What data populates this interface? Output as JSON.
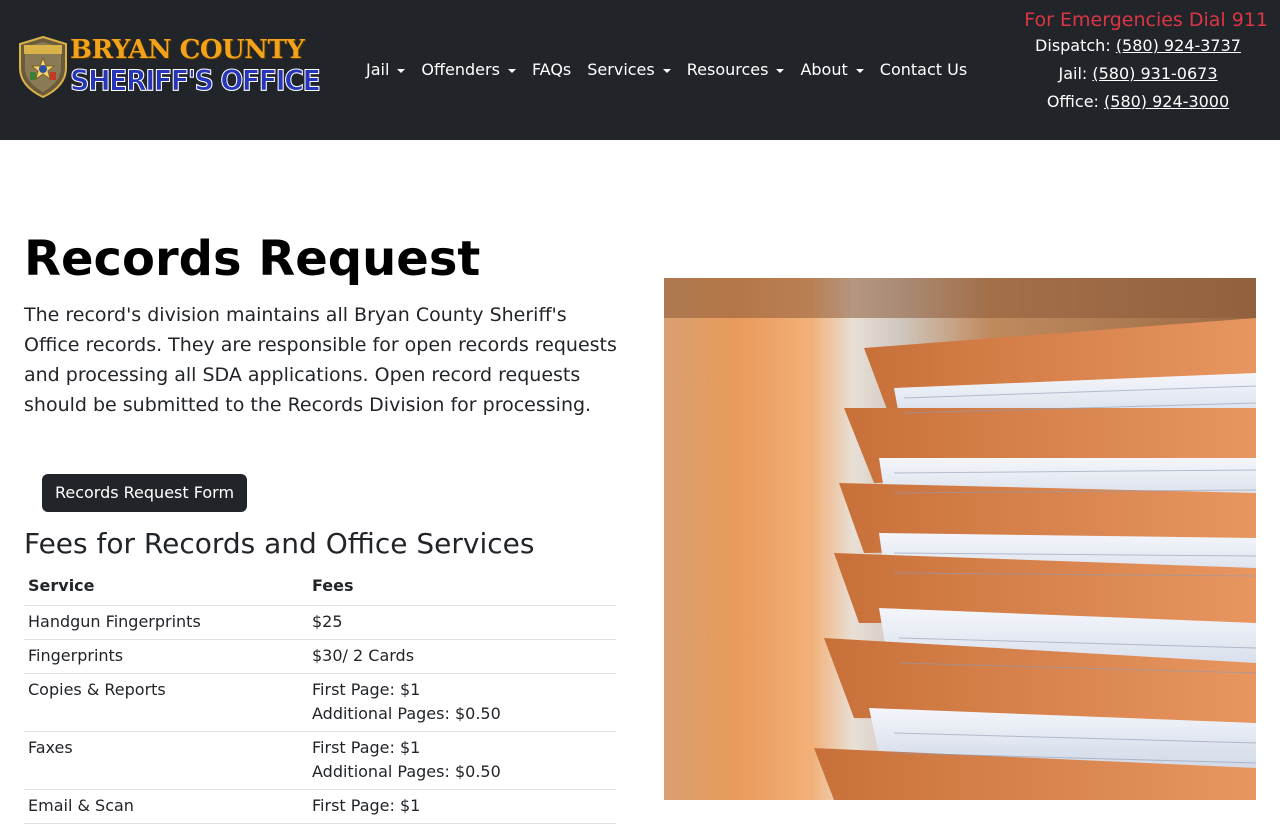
{
  "header": {
    "logo": {
      "line1": "BRYAN COUNTY",
      "line2": "SHERIFF'S OFFICE",
      "badge_text": "SHERIFF"
    },
    "nav": [
      {
        "label": "Jail",
        "dropdown": true
      },
      {
        "label": "Offenders",
        "dropdown": true
      },
      {
        "label": "FAQs",
        "dropdown": false
      },
      {
        "label": "Services",
        "dropdown": true
      },
      {
        "label": "Resources",
        "dropdown": true
      },
      {
        "label": "About",
        "dropdown": true
      },
      {
        "label": "Contact Us",
        "dropdown": false
      }
    ],
    "emergency": "For Emergencies Dial 911",
    "phones": [
      {
        "label": "Dispatch:",
        "number": "(580) 924-3737"
      },
      {
        "label": "Jail:",
        "number": "(580) 931-0673"
      },
      {
        "label": "Office:",
        "number": "(580) 924-3000"
      }
    ]
  },
  "main": {
    "title": "Records Request",
    "intro": "The record's division maintains all Bryan County Sheriff's Office records. They are responsible for open records requests and processing all SDA applications. Open record requests should be submitted to the Records Division for processing.",
    "form_button": "Records Request Form",
    "fees_title": "Fees for Records and Office Services",
    "fees_table": {
      "headers": [
        "Service",
        "Fees"
      ],
      "rows": [
        {
          "service": "Handgun Fingerprints",
          "fees": [
            "$25"
          ]
        },
        {
          "service": "Fingerprints",
          "fees": [
            "$30/ 2 Cards"
          ]
        },
        {
          "service": "Copies & Reports",
          "fees": [
            "First Page: $1",
            "Additional Pages: $0.50"
          ]
        },
        {
          "service": "Faxes",
          "fees": [
            "First Page: $1",
            "Additional Pages: $0.50"
          ]
        },
        {
          "service": "Email & Scan",
          "fees": [
            "First Page: $1"
          ]
        }
      ]
    }
  },
  "colors": {
    "header_bg": "#212529",
    "emergency": "#dc3545",
    "logo_gold": "#f3a21b",
    "logo_blue": "#2736b8"
  },
  "icons": {
    "badge": "sheriff-star-badge-icon",
    "caret": "caret-down-icon"
  }
}
